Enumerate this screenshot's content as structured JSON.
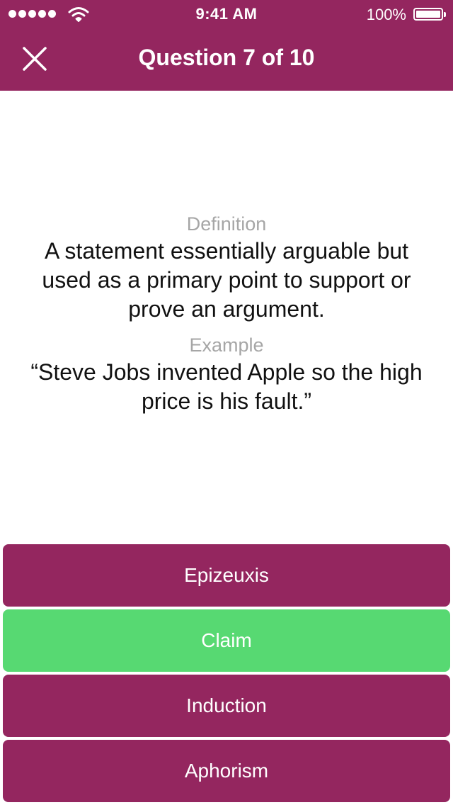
{
  "status_bar": {
    "time": "9:41 AM",
    "battery_percent": "100%",
    "signal_bars": 5
  },
  "header": {
    "title": "Question 7 of 10",
    "close_icon": "close-icon",
    "background_color": "#94265f"
  },
  "question": {
    "definition_label": "Definition",
    "definition_text": "A statement essentially arguable but used as a primary point to support or prove an argument.",
    "example_label": "Example",
    "example_text": "“Steve Jobs invented Apple so the high price is his fault.”"
  },
  "answers": [
    {
      "label": "Epizeuxis",
      "state": "default"
    },
    {
      "label": "Claim",
      "state": "correct"
    },
    {
      "label": "Induction",
      "state": "default"
    },
    {
      "label": "Aphorism",
      "state": "default"
    }
  ],
  "colors": {
    "primary": "#94265f",
    "correct": "#57d972",
    "label_gray": "#a6a6a6"
  }
}
